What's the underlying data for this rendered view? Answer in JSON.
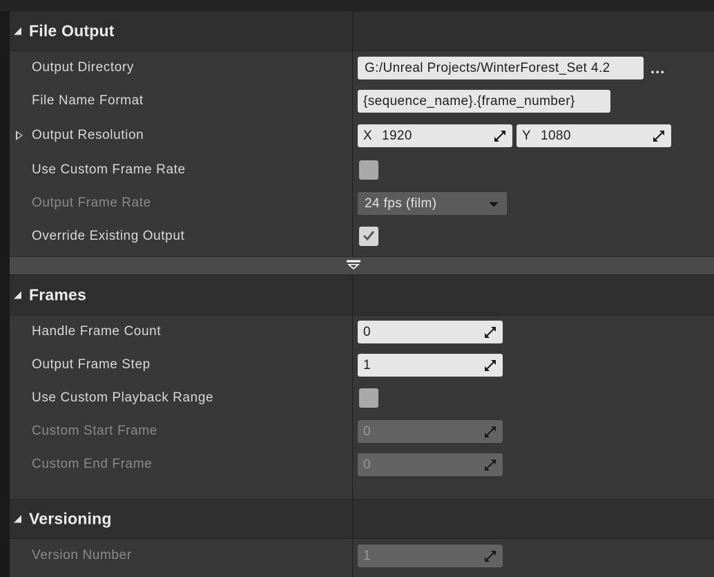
{
  "file_output": {
    "title": "File Output",
    "rows": [
      {
        "label": "Output Directory",
        "value": "G:/Unreal Projects/WinterForest_Set 4.2",
        "browse_label": "..."
      },
      {
        "label": "File Name Format",
        "value": "{sequence_name}.{frame_number}"
      },
      {
        "label": "Output Resolution",
        "x_axis": "X",
        "x_value": "1920",
        "y_axis": "Y",
        "y_value": "1080"
      },
      {
        "label": "Use Custom Frame Rate",
        "checked": false
      },
      {
        "label": "Output Frame Rate",
        "value": "24 fps (film)",
        "enabled": false
      },
      {
        "label": "Override Existing Output",
        "checked": true
      }
    ]
  },
  "frames": {
    "title": "Frames",
    "rows": [
      {
        "label": "Handle Frame Count",
        "value": "0"
      },
      {
        "label": "Output Frame Step",
        "value": "1"
      },
      {
        "label": "Use Custom Playback Range",
        "checked": false
      },
      {
        "label": "Custom Start Frame",
        "value": "0",
        "enabled": false
      },
      {
        "label": "Custom End Frame",
        "value": "0",
        "enabled": false
      }
    ]
  },
  "versioning": {
    "title": "Versioning",
    "rows": [
      {
        "label": "Version Number",
        "value": "1",
        "enabled": false
      }
    ]
  },
  "colors": {
    "panel_bg": "#383838",
    "header_bg": "#2f2f2f",
    "field_bg": "#e6e6e6",
    "field_disabled_bg": "#636363",
    "label_text": "#d9d9d9",
    "label_disabled_text": "#8a8a8a"
  }
}
